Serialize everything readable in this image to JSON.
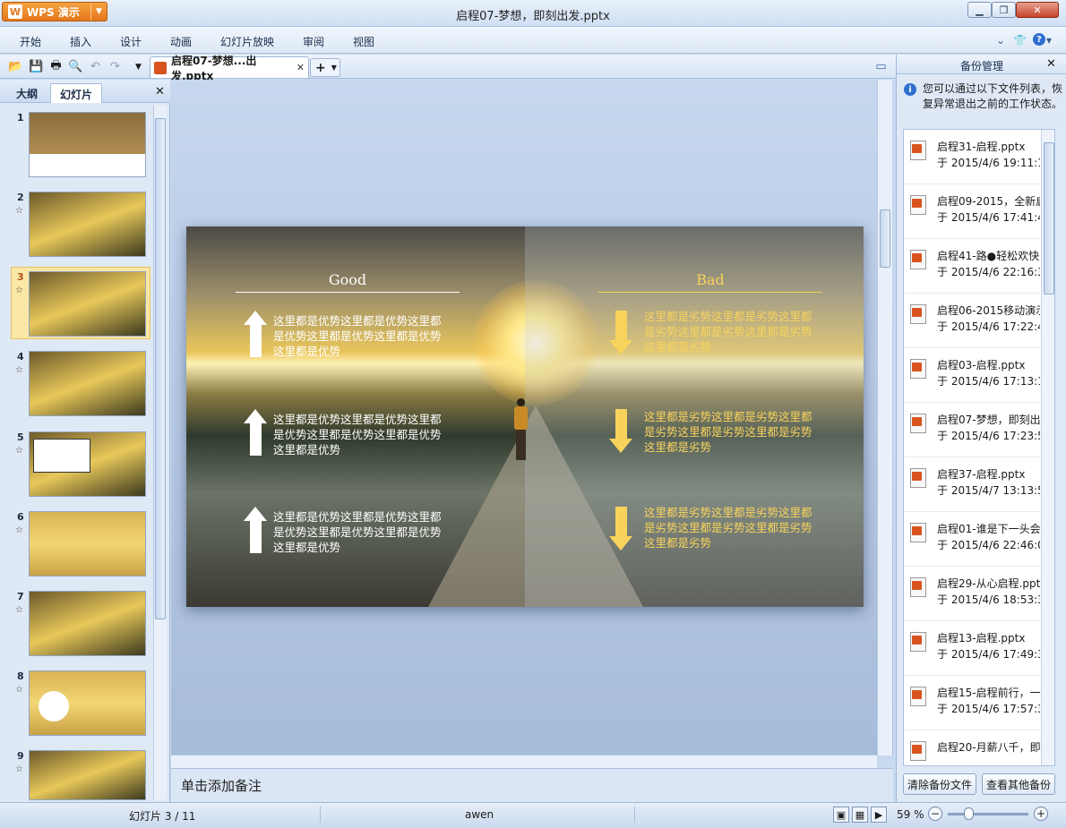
{
  "app": {
    "name": "WPS 演示",
    "logo_letter": "W"
  },
  "window": {
    "title": "启程07-梦想，即刻出发.pptx"
  },
  "menu": [
    "开始",
    "插入",
    "设计",
    "动画",
    "幻灯片放映",
    "审阅",
    "视图"
  ],
  "document_tab": {
    "label": "启程07-梦想...出发.pptx"
  },
  "left_panel": {
    "tabs": [
      "大纲",
      "幻灯片"
    ],
    "slide_numbers": [
      "1",
      "2",
      "3",
      "4",
      "5",
      "6",
      "7",
      "8",
      "9"
    ],
    "selected": "3"
  },
  "slide": {
    "good_title": "Good",
    "bad_title": "Bad",
    "good_items": [
      "这里都是优势这里都是优势这里都是优势这里都是优势这里都是优势这里都是优势",
      "这里都是优势这里都是优势这里都是优势这里都是优势这里都是优势这里都是优势",
      "这里都是优势这里都是优势这里都是优势这里都是优势这里都是优势这里都是优势"
    ],
    "bad_items": [
      "这里都是劣势这里都是劣势这里都是劣势这里都是劣势这里都是劣势这里都是劣势",
      "这里都是劣势这里都是劣势这里都是劣势这里都是劣势这里都是劣势这里都是劣势",
      "这里都是劣势这里都是劣势这里都是劣势这里都是劣势这里都是劣势这里都是劣势"
    ]
  },
  "notes": {
    "placeholder": "单击添加备注"
  },
  "backup": {
    "title": "备份管理",
    "info": "您可以通过以下文件列表，恢复异常退出之前的工作状态。",
    "items": [
      {
        "name": "启程31-启程.pptx",
        "time": "于 2015/4/6 19:11:1"
      },
      {
        "name": "启程09-2015，全新启",
        "time": "于 2015/4/6 17:41:4"
      },
      {
        "name": "启程41-路●轻松欢快",
        "time": "于 2015/4/6 22:16:3"
      },
      {
        "name": "启程06-2015移动演示",
        "time": "于 2015/4/6 17:22:4"
      },
      {
        "name": "启程03-启程.pptx",
        "time": "于 2015/4/6 17:13:1"
      },
      {
        "name": "启程07-梦想，即刻出",
        "time": "于 2015/4/6 17:23:5"
      },
      {
        "name": "启程37-启程.pptx",
        "time": "于 2015/4/7 13:13:5"
      },
      {
        "name": "启程01-谁是下一头会",
        "time": "于 2015/4/6 22:46:0"
      },
      {
        "name": "启程29-从心启程.ppt",
        "time": "于 2015/4/6 18:53:3"
      },
      {
        "name": "启程13-启程.pptx",
        "time": "于 2015/4/6 17:49:3"
      },
      {
        "name": "启程15-启程前行，一",
        "time": "于 2015/4/6 17:57:3"
      },
      {
        "name": "启程20-月薪八千，即",
        "time": ""
      }
    ],
    "btn_clear": "清除备份文件",
    "btn_other": "查看其他备份"
  },
  "status": {
    "slide": "幻灯片 3 / 11",
    "author": "awen",
    "zoom": "59 %"
  }
}
